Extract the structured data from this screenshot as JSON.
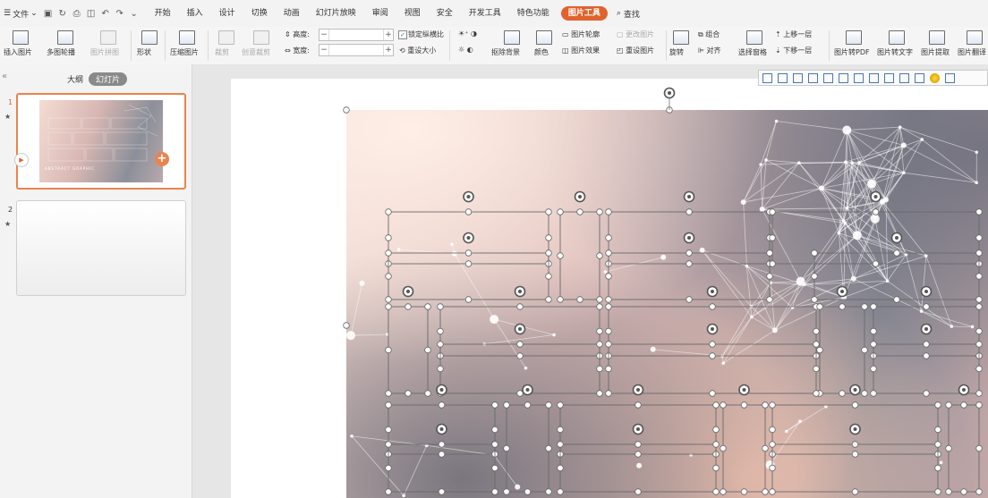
{
  "menubar": {
    "file_label": "文件",
    "tabs": [
      "开始",
      "插入",
      "设计",
      "切换",
      "动画",
      "幻灯片放映",
      "审阅",
      "视图",
      "安全",
      "开发工具",
      "特色功能",
      "图片工具"
    ],
    "active_tab": "图片工具",
    "search_label": "查找"
  },
  "ribbon": {
    "insert_picture": "插入图片",
    "multi_outline": "多图轮播",
    "picture_collage": "图片拼图",
    "shape": "形状",
    "compress": "压缩图片",
    "crop": "裁剪",
    "creative_crop": "创意裁剪",
    "height_label": "高度:",
    "width_label": "宽度:",
    "lock_ratio": "锁定纵横比",
    "reset_size": "重设大小",
    "remove_bg": "抠除背景",
    "color": "颜色",
    "picture_outline": "图片轮廓",
    "picture_effect": "图片效果",
    "change_picture": "更改图片",
    "reset_picture": "重设图片",
    "rotate": "旋转",
    "group": "组合",
    "align": "对齐",
    "selection_pane": "选择窗格",
    "bring_forward": "上移一层",
    "send_backward": "下移一层",
    "pic_to_pdf": "图片转PDF",
    "pic_to_text": "图片转文字",
    "pic_extract": "图片提取",
    "pic_translate": "图片翻译"
  },
  "leftpanel": {
    "outline_tab": "大纲",
    "slides_tab": "幻灯片",
    "slides": [
      {
        "num": "1",
        "caption": "ABSTRACT GRAPHIC"
      },
      {
        "num": "2"
      }
    ]
  },
  "colors": {
    "accent": "#e0622d",
    "selection": "#e8844e"
  }
}
